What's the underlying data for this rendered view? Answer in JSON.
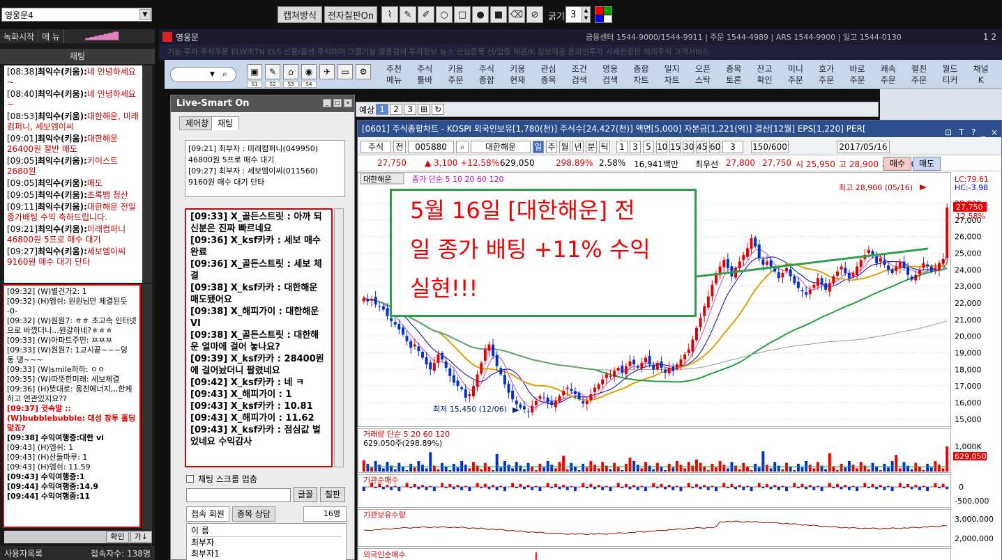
{
  "topbar": {
    "room": "영웅문4",
    "capture": "캡쳐방식",
    "blackboard": "전자칠판On",
    "thickness_label": "굵기",
    "thickness": "3",
    "palette": [
      "#ff0000",
      "#00a000",
      "#0000ff",
      "#ffffff"
    ]
  },
  "left": {
    "record": "녹화시작",
    "menu": "메 뉴",
    "title": "채팅",
    "notices": [
      {
        "t": "[08:38]",
        "n": "최익수(키움):",
        "m": "네 안녕하세요~"
      },
      {
        "t": "[08:40]",
        "n": "최익수(키움):",
        "m": "네 안녕하세요~"
      },
      {
        "t": "[08:53]",
        "n": "최익수(키움):",
        "m": "대한해운, 미래컴퍼니, 세보엠이씨"
      },
      {
        "t": "[09:01]",
        "n": "최익수(키움):",
        "m": "대한해운 26400원 절반 매도"
      },
      {
        "t": "[09:05]",
        "n": "최익수(키움):",
        "m": "키이스트 2680원"
      },
      {
        "t": "[09:05]",
        "n": "최익수(키움):",
        "m": "매도"
      },
      {
        "t": "[09:05]",
        "n": "최익수(키움):",
        "m": "초록뱀 청산"
      },
      {
        "t": "[09:11]",
        "n": "최익수(키움):",
        "m": "대한해운 전일 종가배팅 수익 축하드립니다."
      },
      {
        "t": "[09:21]",
        "n": "최익수(키움):",
        "m": "미래컴퍼니 46800원 5프로 매수 대기"
      },
      {
        "t": "[09:27]",
        "n": "최익수(키움):",
        "m": "세보엠이씨 9160원 매수 대기 단타"
      }
    ],
    "user_chat": [
      {
        "text": "[09:32] (W)별건가2: 1",
        "style": ""
      },
      {
        "text": "[09:32] (H)엠쉬: 원원님만 체결된듯 -0-",
        "style": ""
      },
      {
        "text": "[09:32] (W)원원7: ㅎㅎ 초고속 인터넷으로 바꼈더니...뭔갈하네?ㅎㅎㅎ",
        "style": ""
      },
      {
        "text": "[09:33] (W)아파트주민: ㅉㅉㅉ",
        "style": ""
      },
      {
        "text": "[09:33] (W)원원7: 1교시끝~~~덩 동 댕~~~",
        "style": ""
      },
      {
        "text": "[09:33] (W)smile하하: ㅇㅇ",
        "style": ""
      },
      {
        "text": "[09:35] (W)따뜻한미래: 세보체결",
        "style": ""
      },
      {
        "text": "[09:36] (H)뜻대로: 웅진에너지,,,한케하고 연관있지요??",
        "style": ""
      },
      {
        "text": "[09:37] 귓속말 :: (W)bubblebubble: 대성 창투 홀딩 맞죠?",
        "style": "red"
      },
      {
        "text": "[09:38] 수익여행중:대한 vi",
        "style": "bold"
      },
      {
        "text": "[09:43] (H)엠쉬: 1",
        "style": ""
      },
      {
        "text": "[09:43] (H)산들마루: 1",
        "style": ""
      },
      {
        "text": "[09:43] (H)엠쉬: 11.59",
        "style": ""
      },
      {
        "text": "[09:43] 수익여행중:1",
        "style": "bold"
      },
      {
        "text": "[09:44] 수익여행중:14.9",
        "style": "bold"
      },
      {
        "text": "[09:44] 수익여행중:11",
        "style": "bold"
      }
    ],
    "confirm": "확인",
    "confirm2": "가↓",
    "user_list": "사용자목록",
    "connected": "접속자수: 138명"
  },
  "header": {
    "app": "영웅문",
    "info": "금융센터 1544-9000/1544-9911 | 주문 1544-4989 | ARS 1544-9900 | 일고 1544-0130",
    "pages": "1 2",
    "menu": "기능  투자  주식주문  ELW/ETN  ELS  선물/옵션  주식대여  그룹기능  영웅검색  투자정보  뉴스  관심종목  신/업종  채권/K  정보제공  온라인투자  시세전광판  해외주식  고객서비스"
  },
  "tool2": {
    "slots": [
      "S1",
      "S2",
      "S3",
      "S4"
    ],
    "buttons": [
      [
        "추천",
        "메뉴"
      ],
      [
        "주식",
        "툴바"
      ],
      [
        "키움",
        "주문"
      ],
      [
        "주식",
        "종합"
      ],
      [
        "키움",
        "현재"
      ],
      [
        "관심",
        "종목"
      ],
      [
        "조건",
        "검색"
      ],
      [
        "영웅",
        "검색"
      ],
      [
        "종합",
        "차트"
      ],
      [
        "일지",
        "차트"
      ],
      [
        "오픈",
        "스탁"
      ],
      [
        "종목",
        "토론"
      ],
      [
        "잔고",
        "확인"
      ],
      [
        "미니",
        "주문"
      ],
      [
        "호가",
        "주문"
      ],
      [
        "바로",
        "주문"
      ],
      [
        "쾌속",
        "주문"
      ],
      [
        "펼친",
        "주문"
      ],
      [
        "월드",
        "티커"
      ],
      [
        "채널",
        "K"
      ]
    ]
  },
  "live": {
    "title": "Live-Smart On",
    "tab_control": "제어창",
    "tab_chat": "채팅",
    "notice": [
      "[09:21] 최부자 : 미래컴퍼니(049950)",
      "46800원 5프로 매수 대기",
      "[09:27] 최부자 : 세보엠이씨(011560)",
      "9160원 매수 대기 단타"
    ],
    "chat": [
      "[09:33] X_골든스트릿 : 아까 되신분은 진짜 빠르네요",
      "[09:36] X_ksf카카 : 세보 매수완료",
      "[09:36] X_골든스트릿 : 세보 체결",
      "[09:38] X_ksf카카 : 대한해운 매도됐어요",
      "[09:38] X_해피가이 : 대한해운 VI",
      "[09:38] X_골든스트릿 : 대한해운 얼마에 걸어 놓나요?",
      "[09:39] X_ksf카카 : 28400원에 걸어놨더니 팔렸네요",
      "[09:42] X_ksf카카 : 네 ㅋ",
      "[09:43] X_해피가이 : 1",
      "[09:43] X_ksf카카 : 10.81",
      "[09:43] X_해피가이 : 11.62",
      "[09:43] X_ksf카카 : 점심값 벌었네요 수익감사"
    ],
    "scroll_stop": "채팅 스크롤 멈춤",
    "font_btn": "글꼴",
    "board_btn": "칠판",
    "tab_members": "접속 회원",
    "tab_consult": "종목 상담",
    "count": "16명",
    "col_name": "이 름",
    "users": [
      "최부자",
      "최부자1"
    ]
  },
  "predict": {
    "label": "예상",
    "pages": [
      "1",
      "2",
      "3"
    ]
  },
  "chart_window": {
    "title": "[0601] 주식종합차트 - KOSPI 외국인보유[1,780(천)] 주식수[24,427(천)] 액면[5,000] 자본금[1,221(억)] 결산[12월] EPS[1,220] PER[",
    "market": "주식",
    "gubun": "전",
    "code": "005880",
    "name": "대한해운",
    "periods": [
      "일",
      "주",
      "월",
      "년",
      "분",
      "틱"
    ],
    "minutes": [
      "1",
      "3",
      "5",
      "10",
      "15",
      "30",
      "45",
      "60"
    ],
    "n": "3",
    "count": "150/600",
    "date": "2017/05/16",
    "quote": {
      "price": "27,750",
      "change": "▲ 3,100 +12.58%",
      "volume": "629,050",
      "vol_ratio": "298.89%",
      "rate": "2.58%",
      "amount": "16,941백만",
      "best_ask_label": "최우선",
      "ask": "27,800",
      "bid": "27,750",
      "open": "시 25,950",
      "high": "고 28,900",
      "low": "저 25,700",
      "buy": "매수",
      "sell": "매도"
    }
  },
  "annotation": {
    "line1": "5월 16일 [대한해운] 전",
    "line2": "일 종가 배팅 +11% 수익",
    "line3": "실현!!!"
  },
  "chart_data": {
    "type": "candlestick",
    "title": "대한해운",
    "ma_legend": "종가 단순 5  10  20  60  120",
    "y_ticks": [
      15000,
      16000,
      17000,
      18000,
      19000,
      20000,
      21000,
      22000,
      23000,
      24000,
      25000,
      26000,
      27000,
      28000
    ],
    "ylim": [
      14700,
      29300
    ],
    "last_price": "27,750",
    "last_pct": "12.58%",
    "high_label": "최고 28,900 (05/16)",
    "low_label": "최저 15,450 (12/06)",
    "lc": "LC:79.61",
    "hc": "HC:-3.98",
    "closes": [
      22300,
      22100,
      22250,
      21900,
      21800,
      21600,
      21200,
      20900,
      20700,
      20400,
      20100,
      19700,
      19300,
      19500,
      19100,
      18700,
      18300,
      18000,
      18400,
      18900,
      18600,
      18100,
      17600,
      17200,
      17000,
      16800,
      16300,
      16500,
      17000,
      17700,
      18400,
      19200,
      19500,
      18800,
      18200,
      17700,
      17100,
      16600,
      16200,
      15900,
      15700,
      15600,
      15450,
      15800,
      16100,
      16400,
      16300,
      16000,
      15850,
      16100,
      16400,
      16700,
      16900,
      16700,
      16500,
      16200,
      15950,
      16100,
      16500,
      16900,
      17100,
      17400,
      17700,
      17600,
      17900,
      18100,
      17800,
      18200,
      18500,
      18300,
      18100,
      18400,
      18700,
      18300,
      18000,
      18400,
      18100,
      17800,
      18100,
      17900,
      18300,
      18600,
      18900,
      19200,
      19800,
      20500,
      21100,
      21800,
      22400,
      23100,
      23800,
      24200,
      24600,
      24100,
      23600,
      24100,
      24500,
      24900,
      25300,
      25900,
      25400,
      24700,
      24300,
      24500,
      24200,
      23900,
      23500,
      23800,
      24100,
      23600,
      23200,
      22900,
      22700,
      22500,
      22800,
      23100,
      23500,
      23100,
      22800,
      23200,
      23600,
      23900,
      24200,
      23800,
      23500,
      23800,
      24200,
      24600,
      24900,
      25200,
      24800,
      24400,
      24700,
      24300,
      24000,
      23800,
      24200,
      24500,
      24100,
      23700,
      23400,
      23700,
      24000,
      24400,
      24200,
      23900,
      24100,
      24400,
      24650,
      27750
    ],
    "volume_label": "거래량  단순 5  20  60  120",
    "volume_value": "629,050주(298.89%)",
    "volume_ticks": [
      "1,000K"
    ],
    "inst_label": "기관순매수",
    "inst_ticks": [
      "0",
      "-500,000"
    ],
    "inst_hold_label": "기관보유수량",
    "inst_hold_ticks": [
      "3,000,000",
      "2,000,000"
    ],
    "foreign_label": "외국인순매수"
  }
}
